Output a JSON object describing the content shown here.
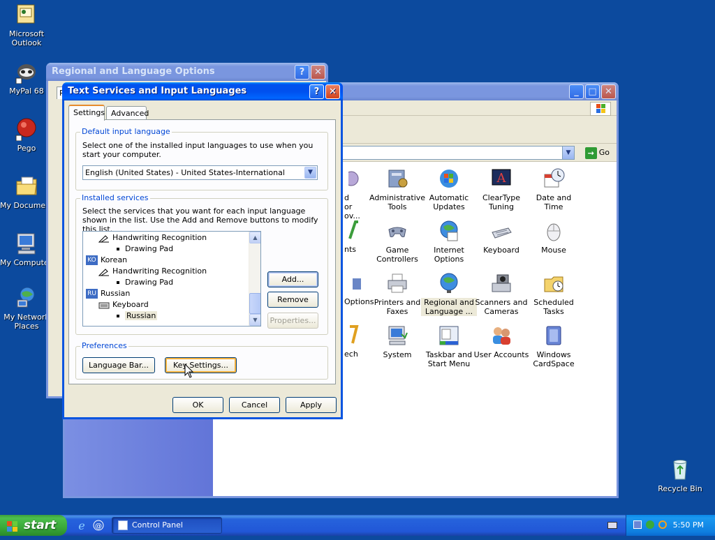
{
  "desktop": {
    "icons": [
      {
        "label": "Microsoft Outlook",
        "icon": "outlook-icon"
      },
      {
        "label": "MyPal 68",
        "icon": "mypal-icon"
      },
      {
        "label": "Pego",
        "icon": "pego-icon"
      },
      {
        "label": "My Documents",
        "icon": "my-documents-icon"
      },
      {
        "label": "My Computer",
        "icon": "my-computer-icon"
      },
      {
        "label": "My Network Places",
        "icon": "network-places-icon"
      },
      {
        "label": "Recycle Bin",
        "icon": "recycle-bin-icon"
      }
    ]
  },
  "control_panel": {
    "go_label": "Go",
    "items": [
      {
        "label": "Administrative Tools",
        "icon": "admin-tools-icon"
      },
      {
        "label": "Automatic Updates",
        "icon": "auto-updates-icon"
      },
      {
        "label": "ClearType Tuning",
        "icon": "cleartype-icon"
      },
      {
        "label": "Date and Time",
        "icon": "date-time-icon"
      },
      {
        "label": "Game Controllers",
        "icon": "gamepad-icon"
      },
      {
        "label": "Internet Options",
        "icon": "internet-options-icon"
      },
      {
        "label": "Keyboard",
        "icon": "keyboard-icon"
      },
      {
        "label": "Mouse",
        "icon": "mouse-icon"
      },
      {
        "label": "Printers and Faxes",
        "icon": "printer-icon"
      },
      {
        "label": "Regional and Language ...",
        "icon": "regional-icon"
      },
      {
        "label": "Scanners and Cameras",
        "icon": "scanner-icon"
      },
      {
        "label": "Scheduled Tasks",
        "icon": "scheduled-tasks-icon"
      },
      {
        "label": "System",
        "icon": "system-icon"
      },
      {
        "label": "Taskbar and Start Menu",
        "icon": "taskbar-icon"
      },
      {
        "label": "User Accounts",
        "icon": "user-accounts-icon"
      },
      {
        "label": "Windows CardSpace",
        "icon": "cardspace-icon"
      }
    ],
    "partial_labels": [
      "d or",
      "ov...",
      "nts",
      "Options",
      "ech"
    ]
  },
  "regional_window": {
    "title": "Regional and Language Options",
    "help_btn": "?",
    "close_btn": "✕",
    "tab_fragment": "R"
  },
  "dialog": {
    "title": "Text Services and Input Languages",
    "help_btn": "?",
    "close_btn": "✕",
    "tabs": [
      {
        "label": "Settings",
        "active": true
      },
      {
        "label": "Advanced",
        "active": false
      }
    ],
    "default_lang": {
      "group_title": "Default input language",
      "description": "Select one of the installed input languages to use when you start your computer.",
      "selected": "English (United States) - United States-International"
    },
    "installed": {
      "group_title": "Installed services",
      "description": "Select the services that you want for each input language shown in the list. Use the Add and Remove buttons to modify this list.",
      "tree": [
        {
          "level": 1,
          "text": "Handwriting Recognition",
          "kind": "pen"
        },
        {
          "level": 2,
          "text": "Drawing Pad",
          "kind": "bullet"
        },
        {
          "level": 0,
          "text": "Korean",
          "kind": "lang",
          "badge": "KO"
        },
        {
          "level": 1,
          "text": "Handwriting Recognition",
          "kind": "pen"
        },
        {
          "level": 2,
          "text": "Drawing Pad",
          "kind": "bullet"
        },
        {
          "level": 0,
          "text": "Russian",
          "kind": "lang",
          "badge": "RU"
        },
        {
          "level": 1,
          "text": "Keyboard",
          "kind": "keyboard"
        },
        {
          "level": 2,
          "text": "Russian",
          "kind": "bullet",
          "selected": true
        }
      ],
      "add_btn": "Add...",
      "remove_btn": "Remove",
      "properties_btn": "Properties..."
    },
    "preferences": {
      "group_title": "Preferences",
      "language_bar_btn": "Language Bar...",
      "key_settings_btn": "Key Settings..."
    },
    "ok_btn": "OK",
    "cancel_btn": "Cancel",
    "apply_btn": "Apply"
  },
  "taskbar": {
    "start_label": "start",
    "task_label": "Control Panel",
    "clock": "5:50 PM"
  },
  "colors": {
    "desktop": "#0c4a9e",
    "title_active": "#0053ee",
    "title_inactive": "#7a96df",
    "start_green": "#3aa93a",
    "group_title": "#0046d5"
  }
}
